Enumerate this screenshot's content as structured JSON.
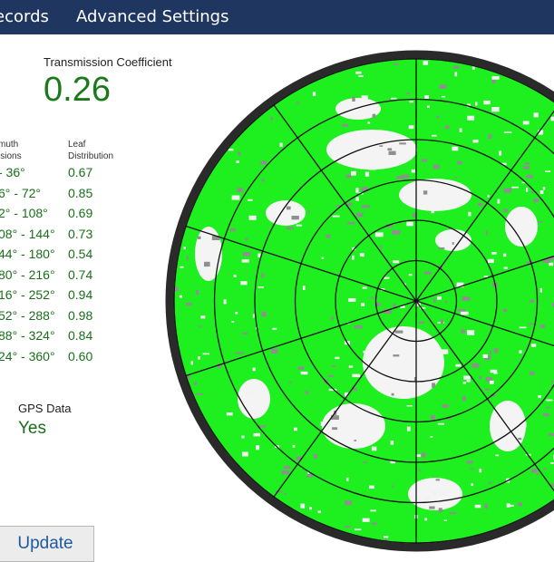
{
  "menu": {
    "items": [
      {
        "label": "ecords"
      },
      {
        "label": "Advanced Settings"
      }
    ]
  },
  "transmission": {
    "label": "Transmission Coefficient",
    "value": "0.26"
  },
  "table": {
    "azimuth_header": [
      "muth",
      "isions"
    ],
    "leaf_header": [
      "Leaf",
      "Distribution"
    ],
    "rows": [
      {
        "range": "- 36°",
        "value": "0.67"
      },
      {
        "range": "6° - 72°",
        "value": "0.85"
      },
      {
        "range": "2° - 108°",
        "value": "0.69"
      },
      {
        "range": "08° - 144°",
        "value": "0.73"
      },
      {
        "range": "44° - 180°",
        "value": "0.54"
      },
      {
        "range": "80° - 216°",
        "value": "0.74"
      },
      {
        "range": "16° - 252°",
        "value": "0.94"
      },
      {
        "range": "52° - 288°",
        "value": "0.98"
      },
      {
        "range": "88° - 324°",
        "value": "0.84"
      },
      {
        "range": "24° - 360°",
        "value": "0.60"
      }
    ]
  },
  "gps": {
    "label": "GPS Data",
    "value": "Yes"
  },
  "update_label": "Update",
  "colors": {
    "menubar": "#1e3660",
    "canopy": "#1eef1e",
    "value_green": "#1a7a1a",
    "rim": "#2a2a2a"
  }
}
